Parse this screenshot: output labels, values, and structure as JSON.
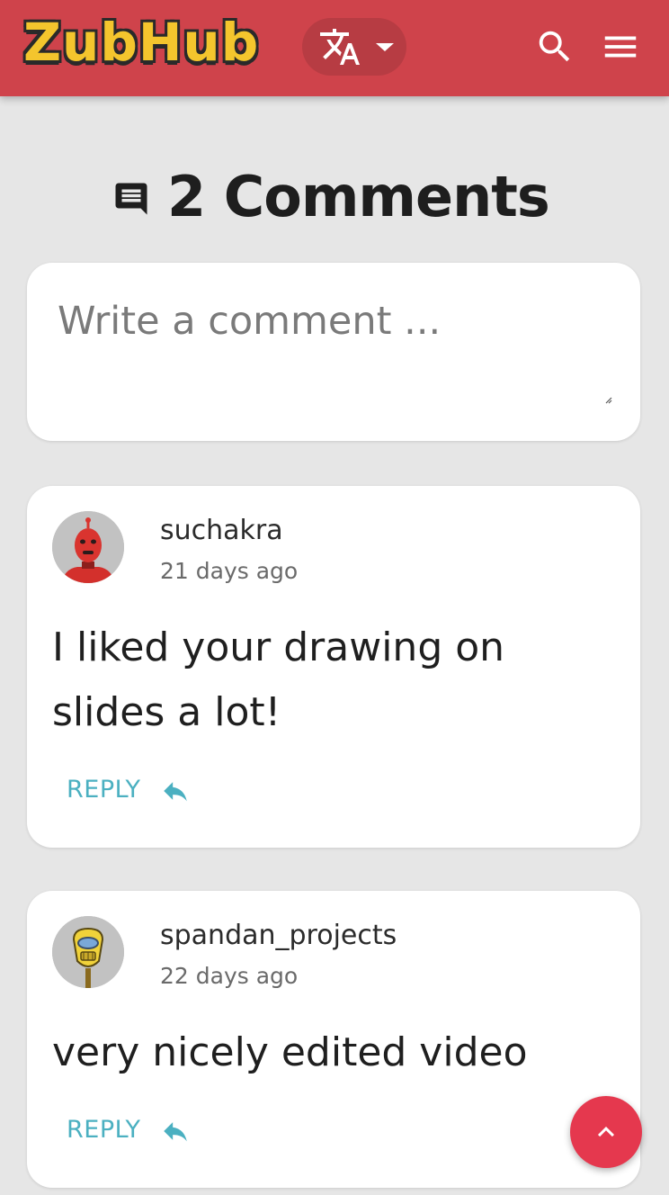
{
  "header": {
    "logo_text": "ZubHub",
    "language_icon": "translate-icon",
    "dropdown_icon": "caret-down-icon",
    "search_icon": "search-icon",
    "menu_icon": "hamburger-menu-icon",
    "background_color": "#cf434b",
    "logo_color": "#f4c52d"
  },
  "comments_section": {
    "icon": "comment-icon",
    "title": "2 Comments",
    "input_placeholder": "Write a comment ..."
  },
  "comments": [
    {
      "username": "suchakra",
      "time_ago": "21 days ago",
      "text": "I liked your drawing on slides a lot!",
      "reply_label": "REPLY",
      "reply_icon": "reply-icon"
    },
    {
      "username": "spandan_projects",
      "time_ago": "22 days ago",
      "text": "very nicely edited video",
      "reply_label": "REPLY",
      "reply_icon": "reply-icon"
    }
  ],
  "scroll_top_button": {
    "icon": "chevron-up-icon",
    "color": "#e5384e"
  },
  "colors": {
    "page_background": "#e6e6e6",
    "accent_teal": "#4bb0c1"
  }
}
